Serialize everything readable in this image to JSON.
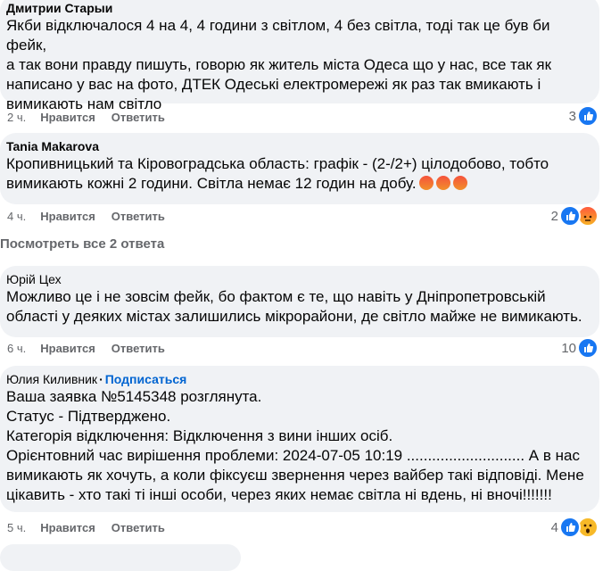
{
  "comments": [
    {
      "author": "Дмитрии Старыи",
      "text_lines": [
        "Якби відключалося 4 на 4, 4 години з світлом, 4 без світла, тоді так це був би фейк,",
        "а так вони правду пишуть, говорю як житель міста Одеса що у нас, все так як",
        "написано у вас на фото, ДТЕК Одеські електромережі як раз так вмикають і",
        "вимикають нам світло"
      ],
      "time": "2 ч.",
      "like_label": "Нравится",
      "reply_label": "Ответить",
      "reaction_count": "3",
      "reactions": [
        "like-icon"
      ]
    },
    {
      "author": "Tania Makarova",
      "text_lines": [
        "Кропивницький та Кіровоградська область: графік - (2-/2+) цілодобово, тобто",
        "вимикають кожні 2 години. Світла немає 12 годин на добу."
      ],
      "inline_emojis": [
        "angry-emoji",
        "angry-emoji",
        "angry-emoji"
      ],
      "time": "4 ч.",
      "like_label": "Нравится",
      "reply_label": "Ответить",
      "reaction_count": "2",
      "reactions": [
        "like-icon",
        "angry-icon"
      ]
    },
    {
      "author": "Юрій Цех",
      "text_lines": [
        "Можливо це і не зовсім фейк, бо фактом є те, що навіть у Дніпропетровській",
        "області у деяких містах залишились мікрорайони, де світло майже не вимикають."
      ],
      "time": "6 ч.",
      "like_label": "Нравится",
      "reply_label": "Ответить",
      "reaction_count": "10",
      "reactions": [
        "like-icon"
      ]
    },
    {
      "author": "Юлия Киливник",
      "subscribe": "Подписаться",
      "text_lines": [
        "Ваша заявка №5145348 розглянута.",
        "Статус - Підтверджено.",
        "Категорія відключення: Відключення з вини інших осіб.",
        "Орієнтовний час вирішення проблеми: 2024-07-05 10:19 ............................ А в нас",
        "вимикають як хочуть, а коли фіксуєш звернення через вайбер такі відповіді. Мене",
        "цікавить - хто такі ті інші особи, через яких немає світла ні вдень, ні вночі!!!!!!!"
      ],
      "time": "5 ч.",
      "like_label": "Нравится",
      "reply_label": "Ответить",
      "reaction_count": "4",
      "reactions": [
        "like-icon",
        "wow-icon"
      ]
    }
  ],
  "view_replies": "Посмотреть все 2 ответа",
  "colors": {
    "bubble": "#f0f2f5",
    "link": "#0064d1",
    "meta": "#65676b",
    "like": "#1877f2"
  }
}
